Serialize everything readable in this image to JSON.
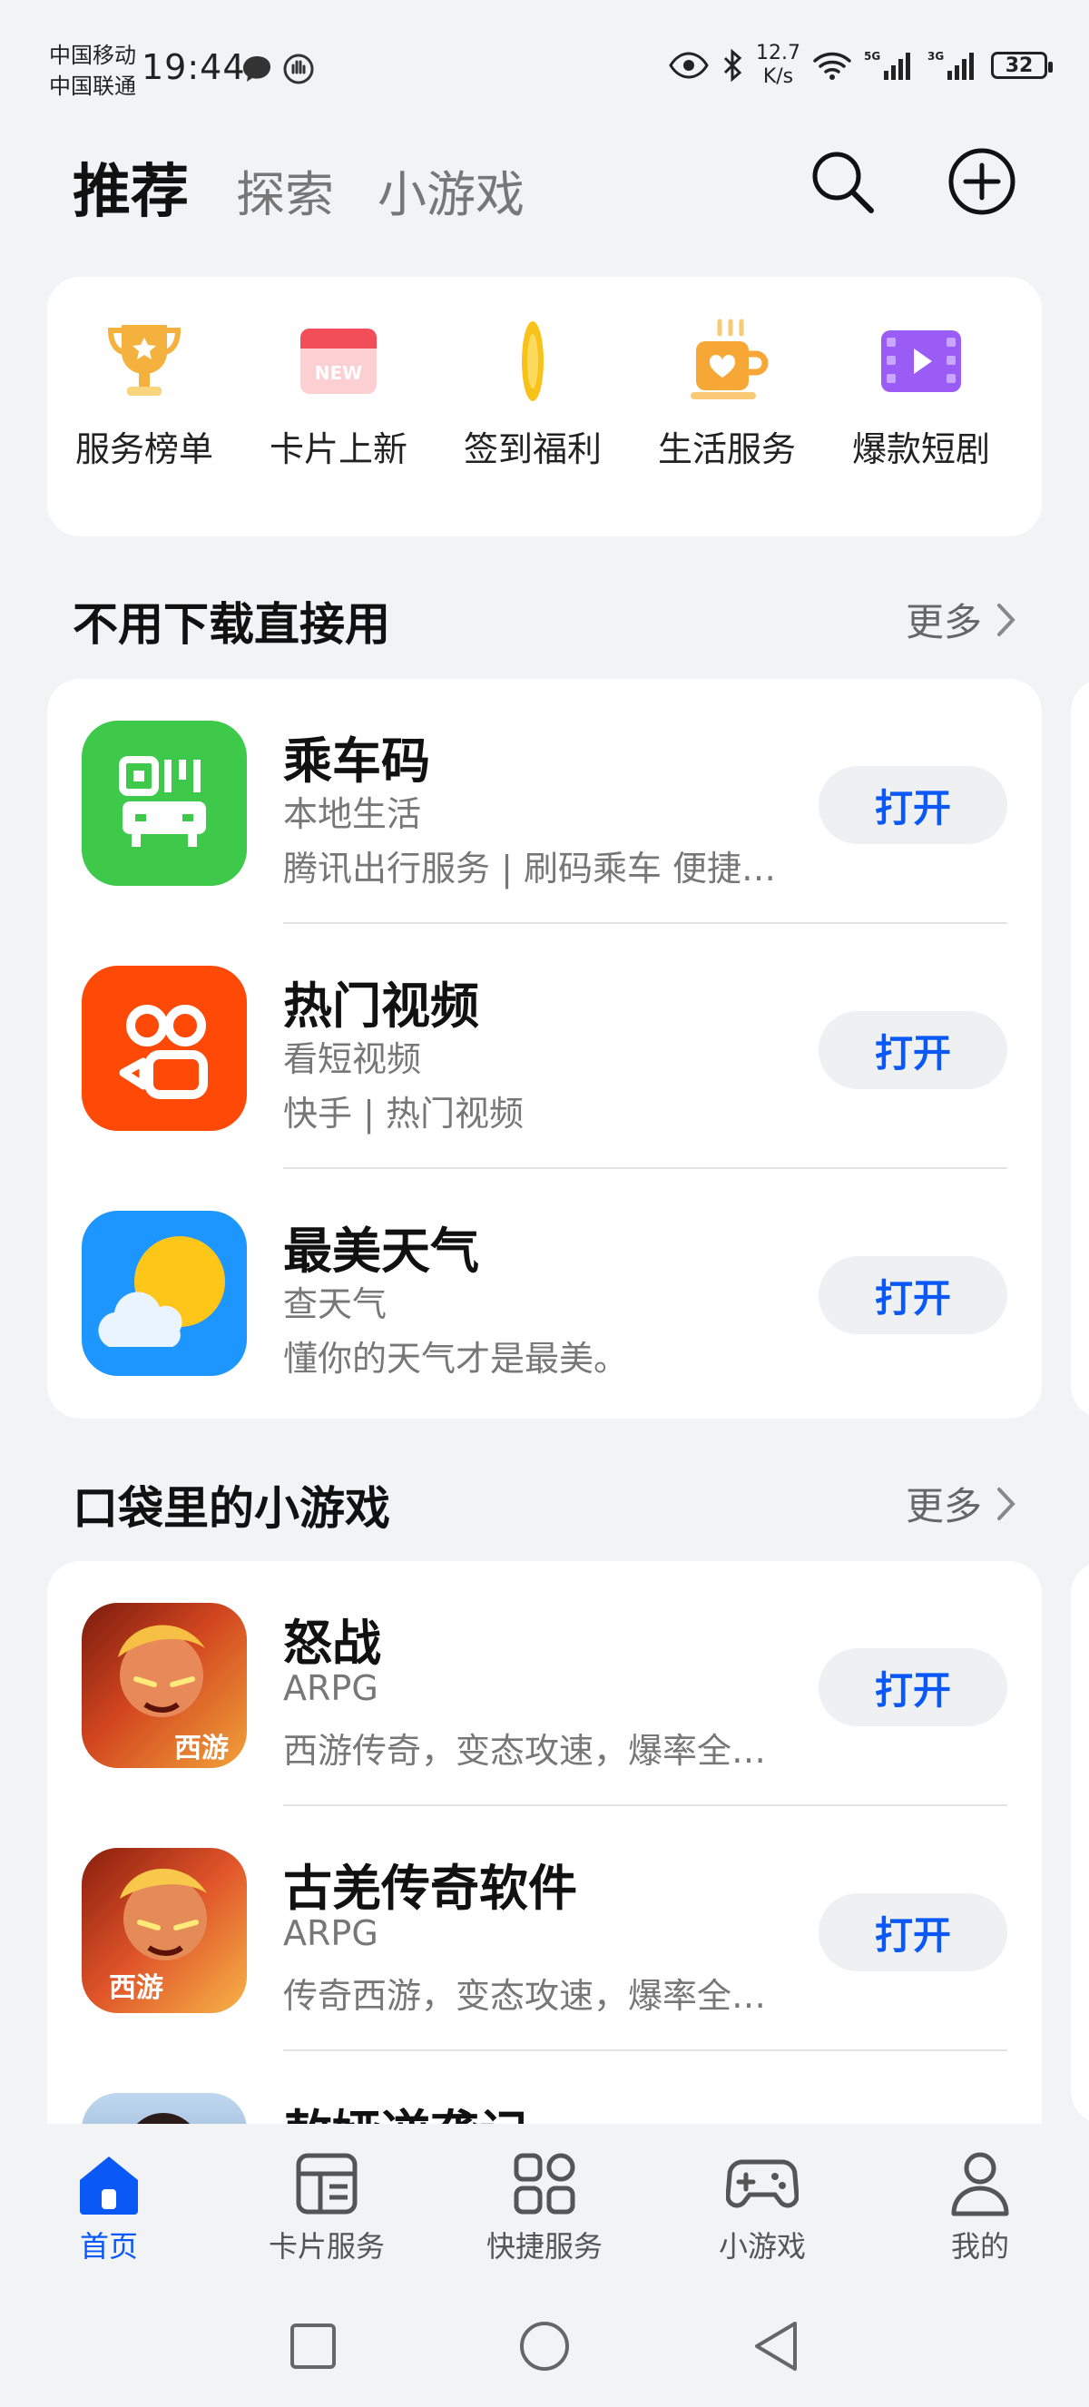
{
  "status_bar": {
    "carrier_1": "中国移动",
    "carrier_2": "中国联通",
    "time": "19:44",
    "speed_value": "12.7",
    "speed_unit": "K/s",
    "battery": "32"
  },
  "header": {
    "tabs": [
      {
        "label": "推荐",
        "active": true
      },
      {
        "label": "探索",
        "active": false
      },
      {
        "label": "小游戏",
        "active": false
      }
    ]
  },
  "quick_entries": [
    {
      "label": "服务榜单",
      "icon": "trophy-icon"
    },
    {
      "label": "卡片上新",
      "icon": "new-card-icon",
      "badge": "NEW"
    },
    {
      "label": "签到福利",
      "icon": "coin-icon"
    },
    {
      "label": "生活服务",
      "icon": "coffee-cup-icon"
    },
    {
      "label": "爆款短剧",
      "icon": "video-film-icon"
    }
  ],
  "section_1": {
    "title": "不用下载直接用",
    "more": "更多",
    "apps": [
      {
        "name": "乘车码",
        "category": "本地生活",
        "desc": "腾讯出行服务 | 刷码乘车 便捷…",
        "button": "打开",
        "icon": "qr-bus-icon"
      },
      {
        "name": "热门视频",
        "category": "看短视频",
        "desc": "快手 | 热门视频",
        "button": "打开",
        "icon": "kuaishou-icon"
      },
      {
        "name": "最美天气",
        "category": "查天气",
        "desc": "懂你的天气才是最美。",
        "button": "打开",
        "icon": "weather-icon"
      }
    ]
  },
  "section_2": {
    "title": "口袋里的小游戏",
    "more": "更多",
    "apps": [
      {
        "name": "怒战",
        "category": "ARPG",
        "desc": "西游传奇，变态攻速，爆率全…",
        "button": "打开",
        "icon": "game-warrior-icon",
        "icon_text": "西游"
      },
      {
        "name": "古羌传奇软件",
        "category": "ARPG",
        "desc": "传奇西游，变态攻速，爆率全…",
        "button": "打开",
        "icon": "game-warrior-icon",
        "icon_text": "西游"
      },
      {
        "name": "敖娅逆袭记",
        "category": "",
        "desc": "",
        "button": "",
        "icon": "game-character-icon"
      }
    ]
  },
  "bottom_nav": [
    {
      "label": "首页",
      "icon": "home-icon",
      "active": true
    },
    {
      "label": "卡片服务",
      "icon": "card-service-icon",
      "active": false
    },
    {
      "label": "快捷服务",
      "icon": "grid-icon",
      "active": false
    },
    {
      "label": "小游戏",
      "icon": "gamepad-icon",
      "active": false
    },
    {
      "label": "我的",
      "icon": "person-icon",
      "active": false
    }
  ],
  "colors": {
    "accent": "#0A59F7",
    "background": "#F1F3F5"
  }
}
